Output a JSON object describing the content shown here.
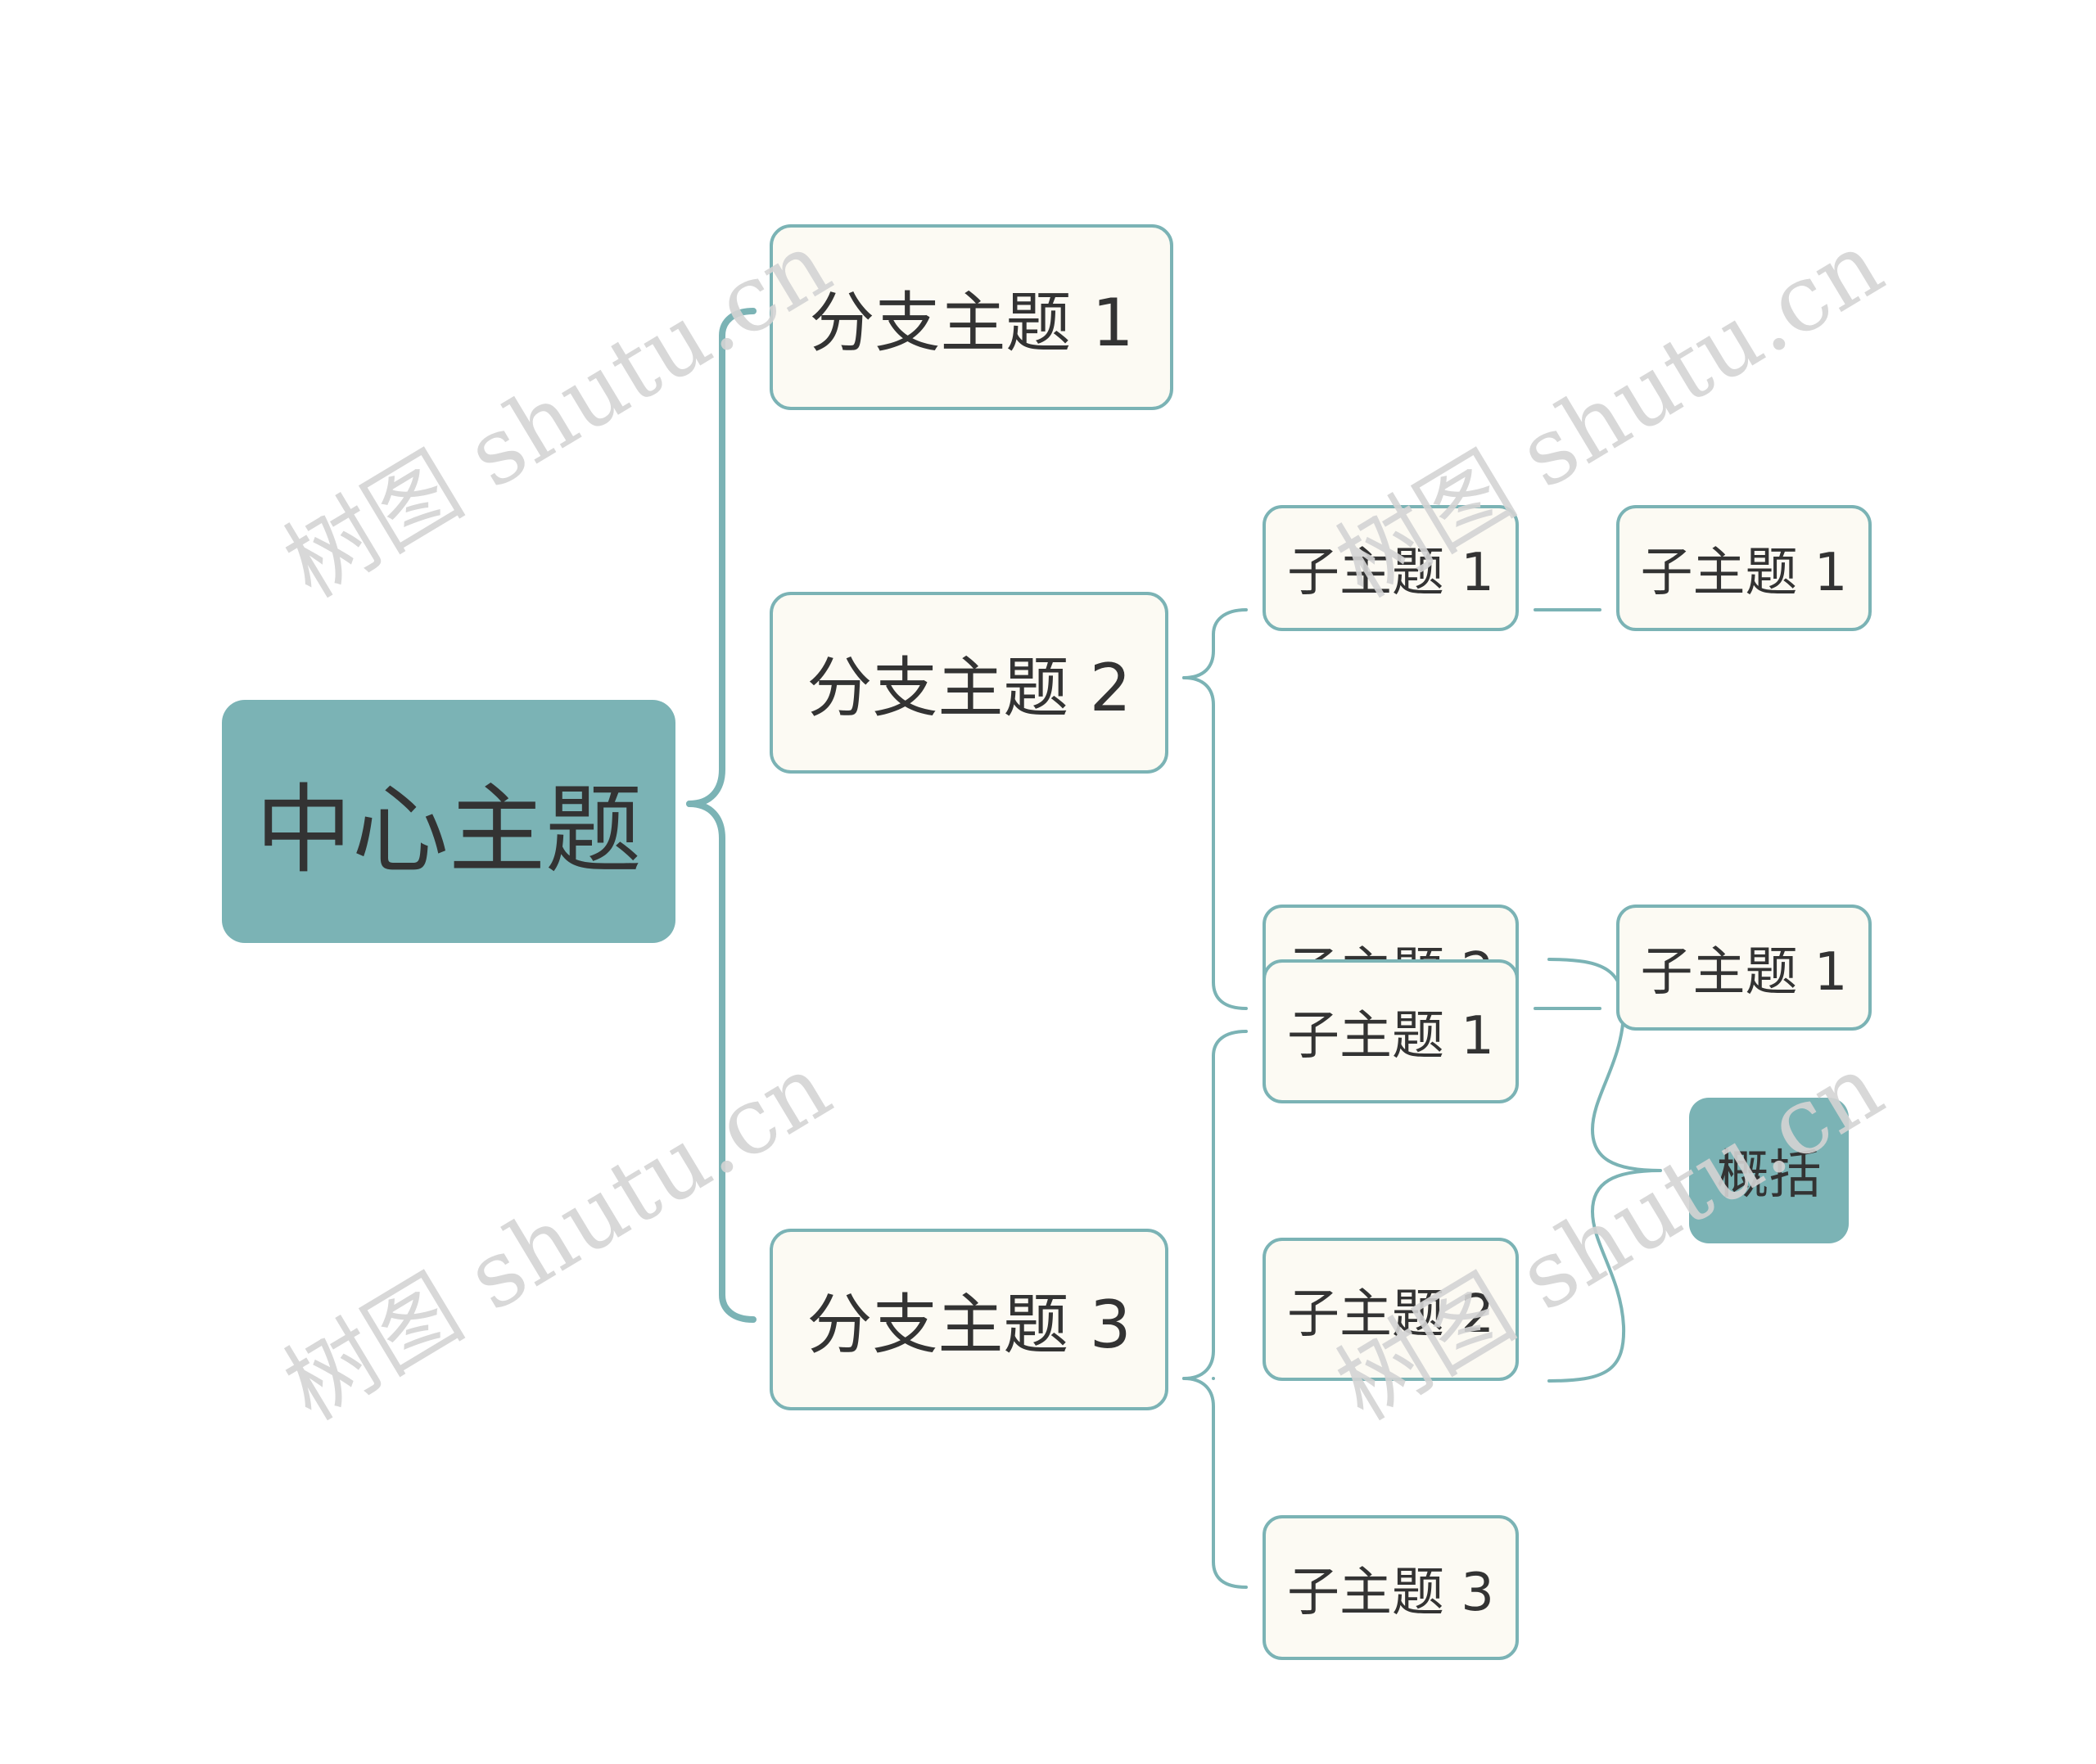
{
  "colors": {
    "accent": "#7bb3b5",
    "node_fill": "#fcfaf3",
    "text": "#333333",
    "watermark": "#d4d4d4"
  },
  "central": {
    "label": "中心主题"
  },
  "branches": [
    {
      "label": "分支主题 1",
      "children": []
    },
    {
      "label": "分支主题 2",
      "children": [
        {
          "label": "子主题 1",
          "children": [
            {
              "label": "子主题 1"
            }
          ]
        },
        {
          "label": "子主题 2",
          "children": [
            {
              "label": "子主题 1"
            }
          ]
        }
      ]
    },
    {
      "label": "分支主题 3",
      "children": [
        {
          "label": "子主题 1"
        },
        {
          "label": "子主题 2"
        },
        {
          "label": "子主题 3"
        }
      ]
    }
  ],
  "summary": {
    "label": "概括",
    "covers": [
      "子主题 1",
      "子主题 2"
    ]
  },
  "watermark": {
    "text": "树图 shutu.cn"
  }
}
